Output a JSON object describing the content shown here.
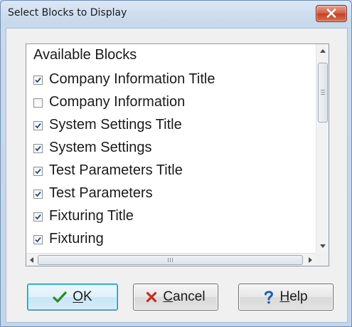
{
  "window": {
    "title": "Select Blocks to Display"
  },
  "list": {
    "header": "Available Blocks",
    "items": [
      {
        "label": "Company Information Title",
        "checked": true
      },
      {
        "label": "Company Information",
        "checked": false
      },
      {
        "label": "System Settings Title",
        "checked": true
      },
      {
        "label": "System Settings",
        "checked": true
      },
      {
        "label": "Test Parameters Title",
        "checked": true
      },
      {
        "label": "Test Parameters",
        "checked": true
      },
      {
        "label": "Fixturing Title",
        "checked": true
      },
      {
        "label": "Fixturing",
        "checked": true
      }
    ]
  },
  "buttons": {
    "ok": {
      "label": "OK",
      "icon": "checkmark-icon",
      "mnemonic": "O"
    },
    "cancel": {
      "label": "Cancel",
      "icon": "x-icon",
      "mnemonic": "C"
    },
    "help": {
      "label": "Help",
      "icon": "question-mark-icon",
      "mnemonic": "H"
    }
  },
  "colors": {
    "ok_icon": "#2e8b1f",
    "cancel_icon": "#c8301e",
    "help_icon": "#1f5fb0"
  }
}
